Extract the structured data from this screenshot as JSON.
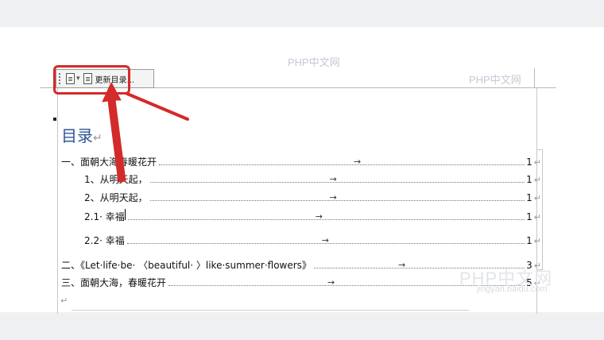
{
  "watermarks": {
    "w1": "PHP中文网",
    "w2": "PHP中文网",
    "w3": "PHP中文网",
    "w4": "jingyan.baidu.com"
  },
  "toolbar": {
    "update_label": "更新目录..."
  },
  "document": {
    "title": "目录",
    "return_mark": "↵",
    "tab_arrow": "→",
    "toc": [
      {
        "text": "一、面朝大海春暖花开",
        "page": "1"
      },
      {
        "text": "1、从明天起，",
        "page": "1"
      },
      {
        "text": "2、从明天起，",
        "page": "1"
      },
      {
        "text": "2.1· 幸福",
        "page": "1"
      },
      {
        "text": "2.2· 幸福",
        "page": "1"
      },
      {
        "text": "二、《Let·life·be· 〈beautiful· 〉like·summer·flowers》",
        "page": "3"
      },
      {
        "text": "三、面朝大海，春暖花开",
        "page": "5"
      }
    ]
  },
  "colors": {
    "highlight": "#d32a2a",
    "title": "#2f5597"
  }
}
